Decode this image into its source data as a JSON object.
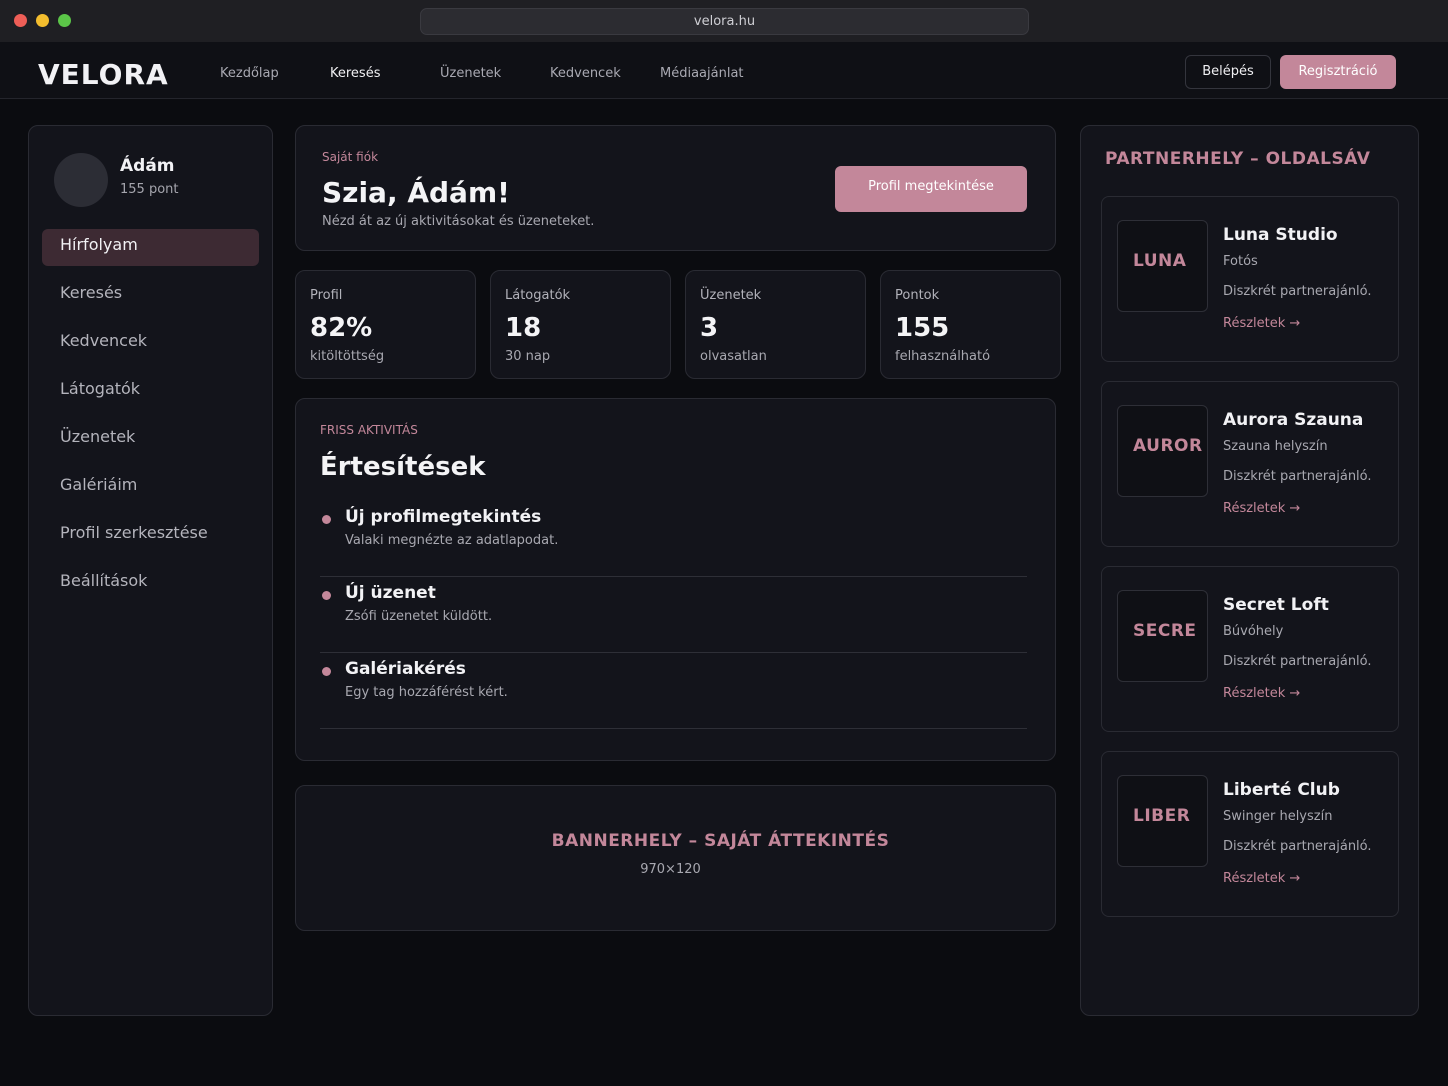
{
  "browser": {
    "url": "velora.hu"
  },
  "nav": {
    "logo": "VELORA",
    "links": [
      "Kezdőlap",
      "Keresés",
      "Üzenetek",
      "Kedvencek",
      "Médiaajánlat"
    ],
    "login": "Belépés",
    "register": "Regisztráció"
  },
  "user": {
    "name": "Ádám",
    "points": "155 pont"
  },
  "sidebar": {
    "items": [
      "Hírfolyam",
      "Keresés",
      "Kedvencek",
      "Látogatók",
      "Üzenetek",
      "Galériáim",
      "Profil szerkesztése",
      "Beállítások"
    ]
  },
  "welcome": {
    "eyebrow": "Saját fiók",
    "title": "Szia, Ádám!",
    "subtitle": "Nézd át az új aktivitásokat és üzeneteket.",
    "button": "Profil megtekintése"
  },
  "stats": [
    {
      "label": "Profil",
      "value": "82%",
      "sub": "kitöltöttség"
    },
    {
      "label": "Látogatók",
      "value": "18",
      "sub": "30 nap"
    },
    {
      "label": "Üzenetek",
      "value": "3",
      "sub": "olvasatlan"
    },
    {
      "label": "Pontok",
      "value": "155",
      "sub": "felhasználható"
    }
  ],
  "notifications": {
    "eyebrow": "FRISS AKTIVITÁS",
    "title": "Értesítések",
    "items": [
      {
        "title": "Új profilmegtekintés",
        "desc": "Valaki megnézte az adatlapodat."
      },
      {
        "title": "Új üzenet",
        "desc": "Zsófi üzenetet küldött."
      },
      {
        "title": "Galériakérés",
        "desc": "Egy tag hozzáférést kért."
      }
    ]
  },
  "banner": {
    "title": "BANNERHELY – SAJÁT ÁTTEKINTÉS",
    "size": "970×120"
  },
  "partners": {
    "title": "PARTNERHELY – OLDALSÁV",
    "items": [
      {
        "logo": "LUNA",
        "name": "Luna Studio",
        "type": "Fotós",
        "desc": "Diszkrét partnerajánló.",
        "link": "Részletek →"
      },
      {
        "logo": "AUROR",
        "name": "Aurora Szauna",
        "type": "Szauna helyszín",
        "desc": "Diszkrét partnerajánló.",
        "link": "Részletek →"
      },
      {
        "logo": "SECRE",
        "name": "Secret Loft",
        "type": "Búvóhely",
        "desc": "Diszkrét partnerajánló.",
        "link": "Részletek →"
      },
      {
        "logo": "LIBER",
        "name": "Liberté Club",
        "type": "Swinger helyszín",
        "desc": "Diszkrét partnerajánló.",
        "link": "Részletek →"
      }
    ]
  },
  "colors": {
    "accent": "#c3879a",
    "background": "#0b0c10",
    "panel": "#13141b",
    "active_item": "#3d2a33"
  }
}
